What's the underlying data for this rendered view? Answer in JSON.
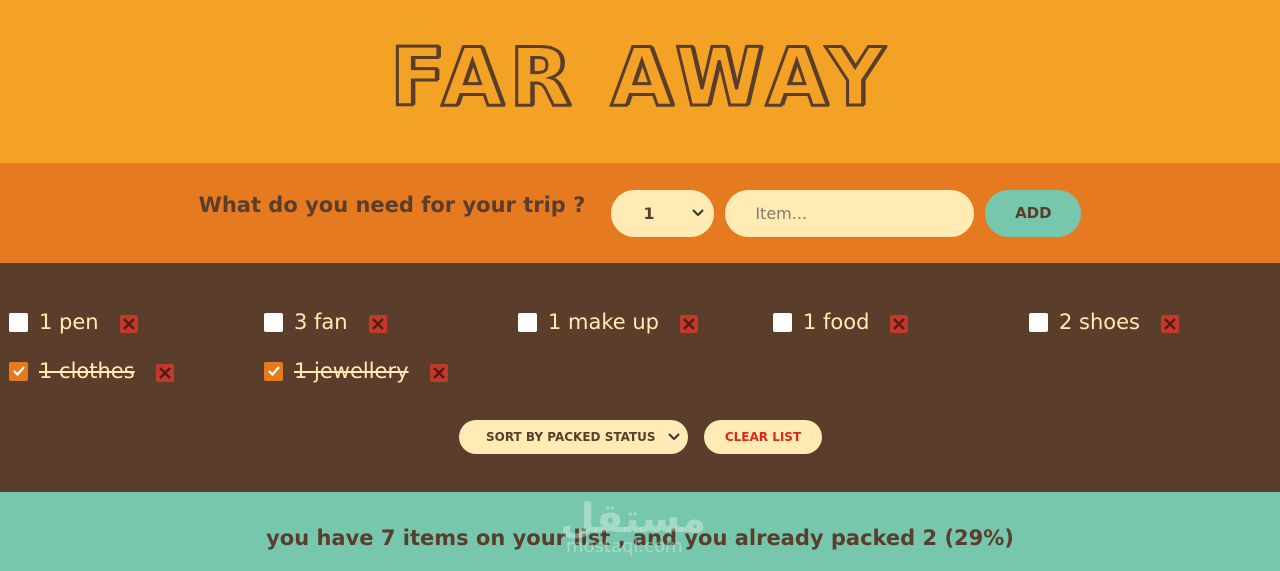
{
  "app": {
    "title": "FAR AWAY"
  },
  "form": {
    "question": "What do you need for your trip ?",
    "quantity_value": "1",
    "item_placeholder": "Item...",
    "add_label": "ADD"
  },
  "items": [
    {
      "label": "1 pen",
      "packed": false
    },
    {
      "label": "3 fan",
      "packed": false
    },
    {
      "label": "1 make up",
      "packed": false
    },
    {
      "label": "1 food",
      "packed": false
    },
    {
      "label": "2 shoes",
      "packed": false
    },
    {
      "label": "1 clothes",
      "packed": true
    },
    {
      "label": "1 jewellery",
      "packed": true
    }
  ],
  "actions": {
    "sort_value": "SORT BY PACKED STATUS",
    "clear_label": "CLEAR LIST"
  },
  "stats": {
    "text": "you have 7 items on your list , and you already packed 2 (29%)"
  },
  "watermark": {
    "main": "مستقل",
    "sub": "mostaql.com"
  },
  "colors": {
    "header": "#f4a226",
    "form": "#e57a20",
    "list": "#5a3e2b",
    "stats": "#76c7ad",
    "accent_red": "#c0392b"
  }
}
